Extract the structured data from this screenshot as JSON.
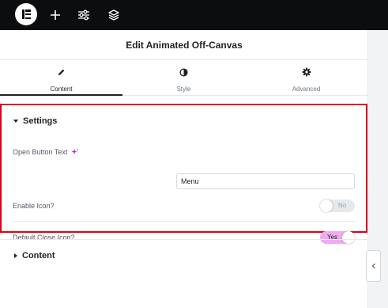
{
  "topbar": {
    "icons": [
      "elementor-logo-icon",
      "plus-icon",
      "sliders-icon",
      "layers-icon"
    ]
  },
  "panel": {
    "title": "Edit Animated Off-Canvas"
  },
  "tabs": [
    {
      "label": "Content",
      "icon": "pencil-icon",
      "active": true
    },
    {
      "label": "Style",
      "icon": "half-circle-icon",
      "active": false
    },
    {
      "label": "Advanced",
      "icon": "gear-icon",
      "active": false
    }
  ],
  "settings": {
    "title": "Settings",
    "open_button_text_label": "Open Button Text",
    "open_button_text_value": "Menu",
    "enable_icon_label": "Enable Icon?",
    "enable_icon_state": "No",
    "default_close_icon_label": "Default Close Icon?",
    "default_close_icon_state": "Yes"
  },
  "content_section": {
    "title": "Content"
  },
  "colors": {
    "accent_pink": "#f0abf4",
    "ai_icon": "#c02bd1",
    "highlight_red": "#e00012"
  }
}
